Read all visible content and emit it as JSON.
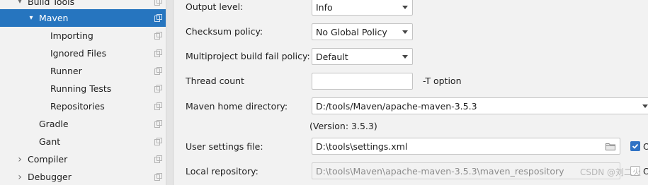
{
  "sidebar": {
    "items": [
      {
        "label": "Build Tools",
        "arrow": "▾"
      },
      {
        "label": "Maven",
        "arrow": "▾"
      },
      {
        "label": "Importing"
      },
      {
        "label": "Ignored Files"
      },
      {
        "label": "Runner"
      },
      {
        "label": "Running Tests"
      },
      {
        "label": "Repositories"
      },
      {
        "label": "Gradle"
      },
      {
        "label": "Gant"
      },
      {
        "label": "Compiler",
        "arrow": "›"
      },
      {
        "label": "Debugger",
        "arrow": "›"
      }
    ]
  },
  "form": {
    "output_level": {
      "label": "Output level:",
      "value": "Info"
    },
    "checksum_policy": {
      "label": "Checksum policy:",
      "value": "No Global Policy"
    },
    "multiproject_policy": {
      "label": "Multiproject build fail policy:",
      "value": "Default"
    },
    "thread_count": {
      "label": "Thread count",
      "value": "",
      "hint": "-T option"
    },
    "maven_home": {
      "label": "Maven home directory:",
      "value": "D:/tools/Maven/apache-maven-3.5.3",
      "version": "(Version: 3.5.3)"
    },
    "user_settings": {
      "label": "User settings file:",
      "value": "D:\\tools\\settings.xml",
      "override_label": "O"
    },
    "local_repo": {
      "label": "Local repository:",
      "value": "D:\\tools\\Maven\\apache-maven-3.5.3\\maven_respository",
      "override_label": "O"
    }
  },
  "watermark": "CSDN @刘二火",
  "colors": {
    "selection": "#2675bf",
    "checkbox": "#2f72c4"
  }
}
